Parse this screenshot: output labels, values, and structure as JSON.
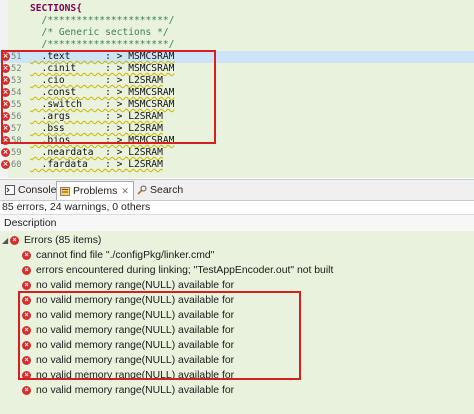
{
  "editor": {
    "lines": [
      {
        "num": "",
        "text": "SECTIONS{",
        "kind": "kw",
        "error": false,
        "highlight": false
      },
      {
        "num": "",
        "text": "  /*********************/",
        "kind": "cm",
        "error": false,
        "highlight": false
      },
      {
        "num": "",
        "text": "  /* Generic sections */",
        "kind": "cm",
        "error": false,
        "highlight": false
      },
      {
        "num": "",
        "text": "  /*********************/",
        "kind": "cm",
        "error": false,
        "highlight": false
      },
      {
        "num": "51",
        "text": "  .text      : > MSMCSRAM",
        "kind": "sec",
        "error": true,
        "highlight": true
      },
      {
        "num": "52",
        "text": "  .cinit     : > MSMCSRAM",
        "kind": "sec",
        "error": true,
        "highlight": false
      },
      {
        "num": "53",
        "text": "  .cio       : > L2SRAM",
        "kind": "sec",
        "error": true,
        "highlight": false
      },
      {
        "num": "54",
        "text": "  .const     : > MSMCSRAM",
        "kind": "sec",
        "error": true,
        "highlight": false
      },
      {
        "num": "55",
        "text": "  .switch    : > MSMCSRAM",
        "kind": "sec",
        "error": true,
        "highlight": false
      },
      {
        "num": "56",
        "text": "  .args      : > L2SRAM",
        "kind": "sec",
        "error": true,
        "highlight": false
      },
      {
        "num": "57",
        "text": "  .bss       : > L2SRAM",
        "kind": "sec",
        "error": true,
        "highlight": false
      },
      {
        "num": "58",
        "text": "  .bios      : > MSMCSRAM",
        "kind": "sec",
        "error": true,
        "highlight": false
      },
      {
        "num": "59",
        "text": "  .neardata  : > L2SRAM",
        "kind": "sec",
        "error": true,
        "highlight": false
      },
      {
        "num": "60",
        "text": "  .fardata   : > L2SRAM",
        "kind": "sec",
        "error": true,
        "highlight": false
      }
    ]
  },
  "tabs": [
    {
      "label": "Console",
      "icon": "console-icon",
      "active": false
    },
    {
      "label": "Problems",
      "icon": "problems-icon",
      "active": true
    },
    {
      "label": "Search",
      "icon": "search-icon",
      "active": false
    }
  ],
  "tab_close": "✕",
  "summary": "85 errors, 24 warnings, 0 others",
  "column_header": "Description",
  "problems": [
    {
      "text": "Errors (85 items)",
      "group": true
    },
    {
      "text": "cannot find file \"./configPkg/linker.cmd\"",
      "group": false
    },
    {
      "text": "errors encountered during linking; \"TestAppEncoder.out\" not built",
      "group": false
    },
    {
      "text": "no valid memory range(NULL) available for",
      "group": false
    },
    {
      "text": "no valid memory range(NULL) available for",
      "group": false
    },
    {
      "text": "no valid memory range(NULL) available for",
      "group": false
    },
    {
      "text": "no valid memory range(NULL) available for",
      "group": false
    },
    {
      "text": "no valid memory range(NULL) available for",
      "group": false
    },
    {
      "text": "no valid memory range(NULL) available for",
      "group": false
    },
    {
      "text": "no valid memory range(NULL) available for",
      "group": false
    },
    {
      "text": "no valid memory range(NULL) available for",
      "group": false
    }
  ],
  "colors": {
    "error": "#d32f2f",
    "annotation": "#d42020",
    "selection": "#cde3f7"
  }
}
